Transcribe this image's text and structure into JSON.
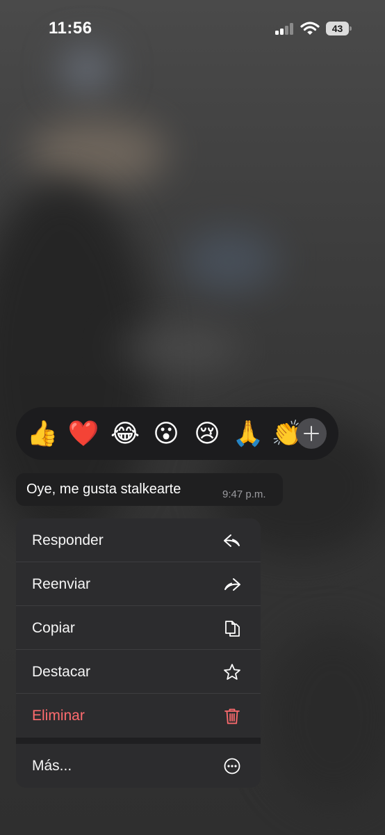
{
  "status_bar": {
    "time": "11:56",
    "battery": "43"
  },
  "reactions": {
    "emojis": [
      "👍",
      "❤️",
      "😂",
      "😮",
      "😢",
      "🙏",
      "👏"
    ],
    "more_icon": "plus-icon"
  },
  "message": {
    "text": "Oye, me gusta stalkearte",
    "time": "9:47 p.m."
  },
  "menu": {
    "items": [
      {
        "label": "Responder",
        "icon": "reply-arrow-icon"
      },
      {
        "label": "Reenviar",
        "icon": "forward-arrow-icon"
      },
      {
        "label": "Copiar",
        "icon": "copy-documents-icon"
      },
      {
        "label": "Destacar",
        "icon": "star-icon"
      },
      {
        "label": "Eliminar",
        "icon": "trash-icon"
      },
      {
        "label": "Más...",
        "icon": "ellipsis-circle-icon"
      }
    ]
  },
  "colors": {
    "danger": "#ff6b6e",
    "menu_bg": "#2c2c2e",
    "bubble_bg": "#1f1f20"
  }
}
